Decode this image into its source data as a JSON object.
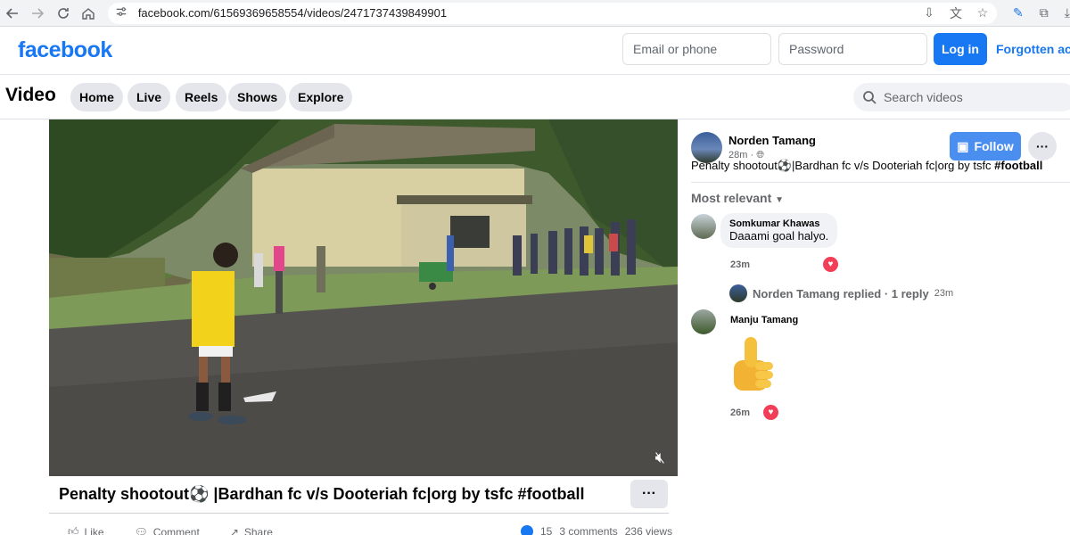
{
  "browser": {
    "url": "facebook.com/61569369658554/videos/2471737439849901"
  },
  "header": {
    "logo": "facebook",
    "email_placeholder": "Email or phone",
    "password_placeholder": "Password",
    "login_label": "Log in",
    "forgot_label": "Forgotten acc"
  },
  "video_nav": {
    "title": "Video",
    "tabs": [
      {
        "label": "Home"
      },
      {
        "label": "Live"
      },
      {
        "label": "Reels"
      },
      {
        "label": "Shows"
      },
      {
        "label": "Explore"
      }
    ],
    "search_placeholder": "Search videos"
  },
  "post": {
    "title": "Penalty shootout⚽ |Bardhan fc v/s Dooteriah fc|org by tsfc #football",
    "actions": {
      "like": "Like",
      "comment": "Comment",
      "share": "Share"
    },
    "stats": {
      "reactions": "15",
      "comments": "3 comments",
      "views": "236 views"
    }
  },
  "panel": {
    "author": "Norden Tamang",
    "time": "28m",
    "follow_label": "Follow",
    "description": "Penalty shootout⚽|Bardhan fc v/s Dooteriah fc|org by tsfc ",
    "hashtag": "#football",
    "sort_label": "Most relevant",
    "comments": [
      {
        "name": "Somkumar Khawas",
        "text": "Daaami goal halyo.",
        "time": "23m"
      },
      {
        "name": "Manju Tamang",
        "text": "",
        "time": "26m"
      }
    ],
    "reply": {
      "text": "Norden Tamang replied · 1 reply",
      "time": "23m"
    }
  },
  "colors": {
    "brand": "#1877f2",
    "heart": "#f33e58"
  }
}
